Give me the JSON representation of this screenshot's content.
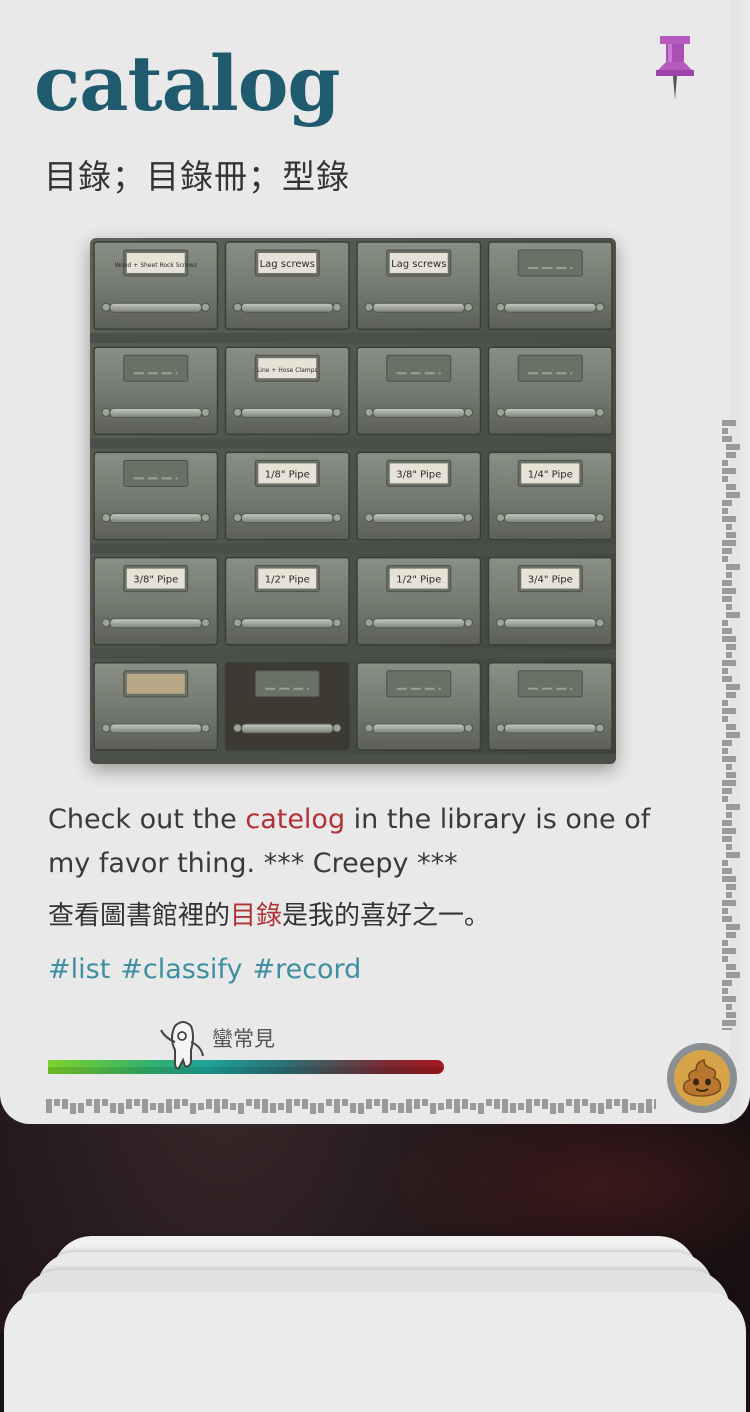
{
  "card": {
    "word": "catalog",
    "translation": "目錄；目錄冊；型錄",
    "sentence_en": {
      "before": "Check out the ",
      "highlight": "catelog",
      "after": " in the library is one of my favor thing. *** Creepy ***"
    },
    "sentence_zh": {
      "before": "查看圖書館裡的",
      "highlight": "目錄",
      "after": "是我的喜好之一。"
    },
    "tags": [
      "#list",
      "#classify",
      "#record"
    ],
    "frequency": {
      "label": "蠻常見",
      "level": 0.34
    },
    "photo": {
      "drawer_labels": [
        [
          "Wood + Sheet Rock Screws",
          "Lag screws",
          "Lag screws",
          ""
        ],
        [
          "",
          "Line + Hose Clamps",
          "",
          ""
        ],
        [
          "",
          "1/8\" Pipe",
          "3/8\" Pipe",
          "1/4\" Pipe"
        ],
        [
          "3/8\" Pipe",
          "1/2\" Pipe",
          "1/2\" Pipe",
          "3/4\" Pipe"
        ],
        [
          "",
          "",
          "",
          ""
        ]
      ]
    }
  },
  "icons": {
    "pin": "pushpin-icon",
    "avatar": "poop-emoji-icon",
    "frequency_marker": "mascot-icon"
  },
  "colors": {
    "title": "#1f5a6e",
    "highlight": "#b03236",
    "tag": "#3e8fa0",
    "pin": "#b55bc0"
  }
}
